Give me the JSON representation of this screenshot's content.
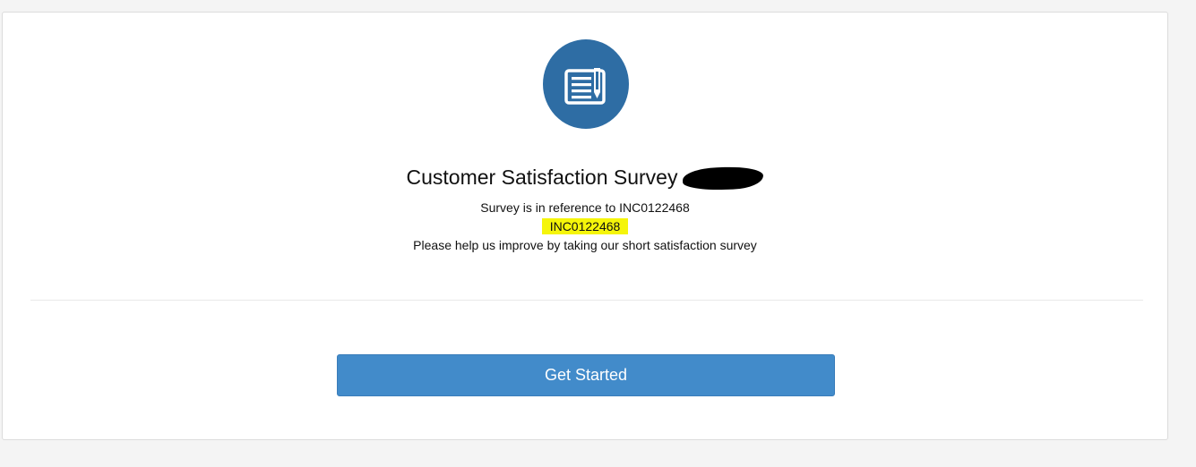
{
  "survey": {
    "title": "Customer Satisfaction Survey",
    "reference_text": "Survey is in reference to INC0122468",
    "incident_number": "INC0122468",
    "help_text": "Please help us improve by taking our short satisfaction survey",
    "icon": "survey-document-icon"
  },
  "actions": {
    "get_started_label": "Get Started"
  },
  "colors": {
    "icon_circle": "#2e6da4",
    "button": "#428bca",
    "highlight": "#f5f50a",
    "page_background": "#f4f4f4"
  }
}
